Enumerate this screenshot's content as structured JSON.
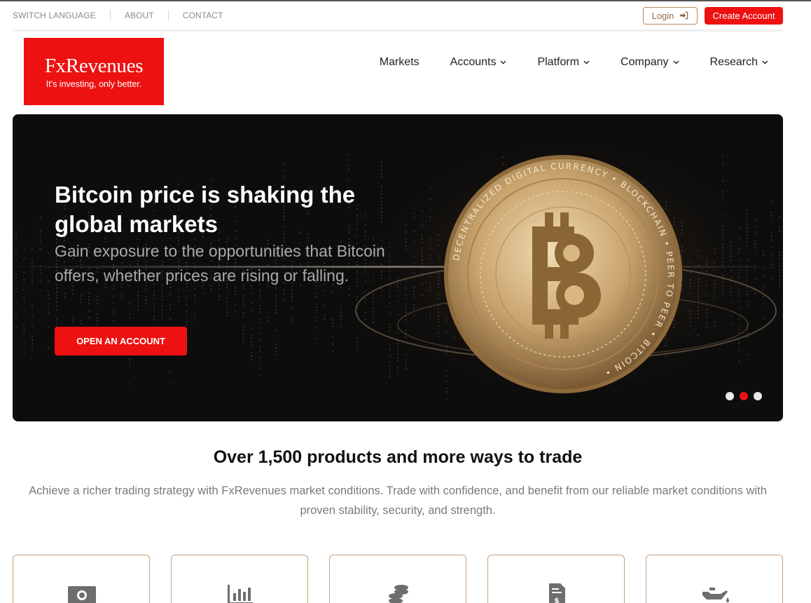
{
  "utility_nav": {
    "links": [
      "SWITCH LANGUAGE",
      "ABOUT",
      "CONTACT"
    ],
    "login_label": "Login",
    "create_account_label": "Create Account"
  },
  "brand": {
    "name": "FxRevenues",
    "tagline": "It's investing, only better."
  },
  "main_nav": {
    "items": [
      {
        "label": "Markets",
        "has_dropdown": false
      },
      {
        "label": "Accounts",
        "has_dropdown": true
      },
      {
        "label": "Platform",
        "has_dropdown": true
      },
      {
        "label": "Company",
        "has_dropdown": true
      },
      {
        "label": "Research",
        "has_dropdown": true
      }
    ]
  },
  "hero": {
    "title": "Bitcoin price is shaking the global markets",
    "subtitle": "Gain exposure to the opportunities that Bitcoin offers, whether prices are rising or falling.",
    "cta_label": "OPEN AN ACCOUNT",
    "image_icon": "bitcoin-coin",
    "coin_ring_text": "DECENTRALIZED DIGITAL CURRENCY • BLOCKCHAIN • PEER TO PEER • BITCOIN •",
    "slides_total": 3,
    "active_slide": 2
  },
  "products_section": {
    "title": "Over 1,500 products and more ways to trade",
    "description": "Achieve a richer trading strategy with FxRevenues market conditions. Trade with confidence, and benefit from our reliable market conditions with proven stability, security, and strength."
  },
  "product_cards": [
    {
      "icon": "cash-icon"
    },
    {
      "icon": "bar-chart-icon"
    },
    {
      "icon": "coins-icon"
    },
    {
      "icon": "dollar-document-icon"
    },
    {
      "icon": "oil-can-icon"
    }
  ],
  "colors": {
    "brand_red": "#ee1111",
    "accent_brown": "#b9865a",
    "hero_bg": "#0d0d0d",
    "coin_gold": "#c9a46e"
  }
}
